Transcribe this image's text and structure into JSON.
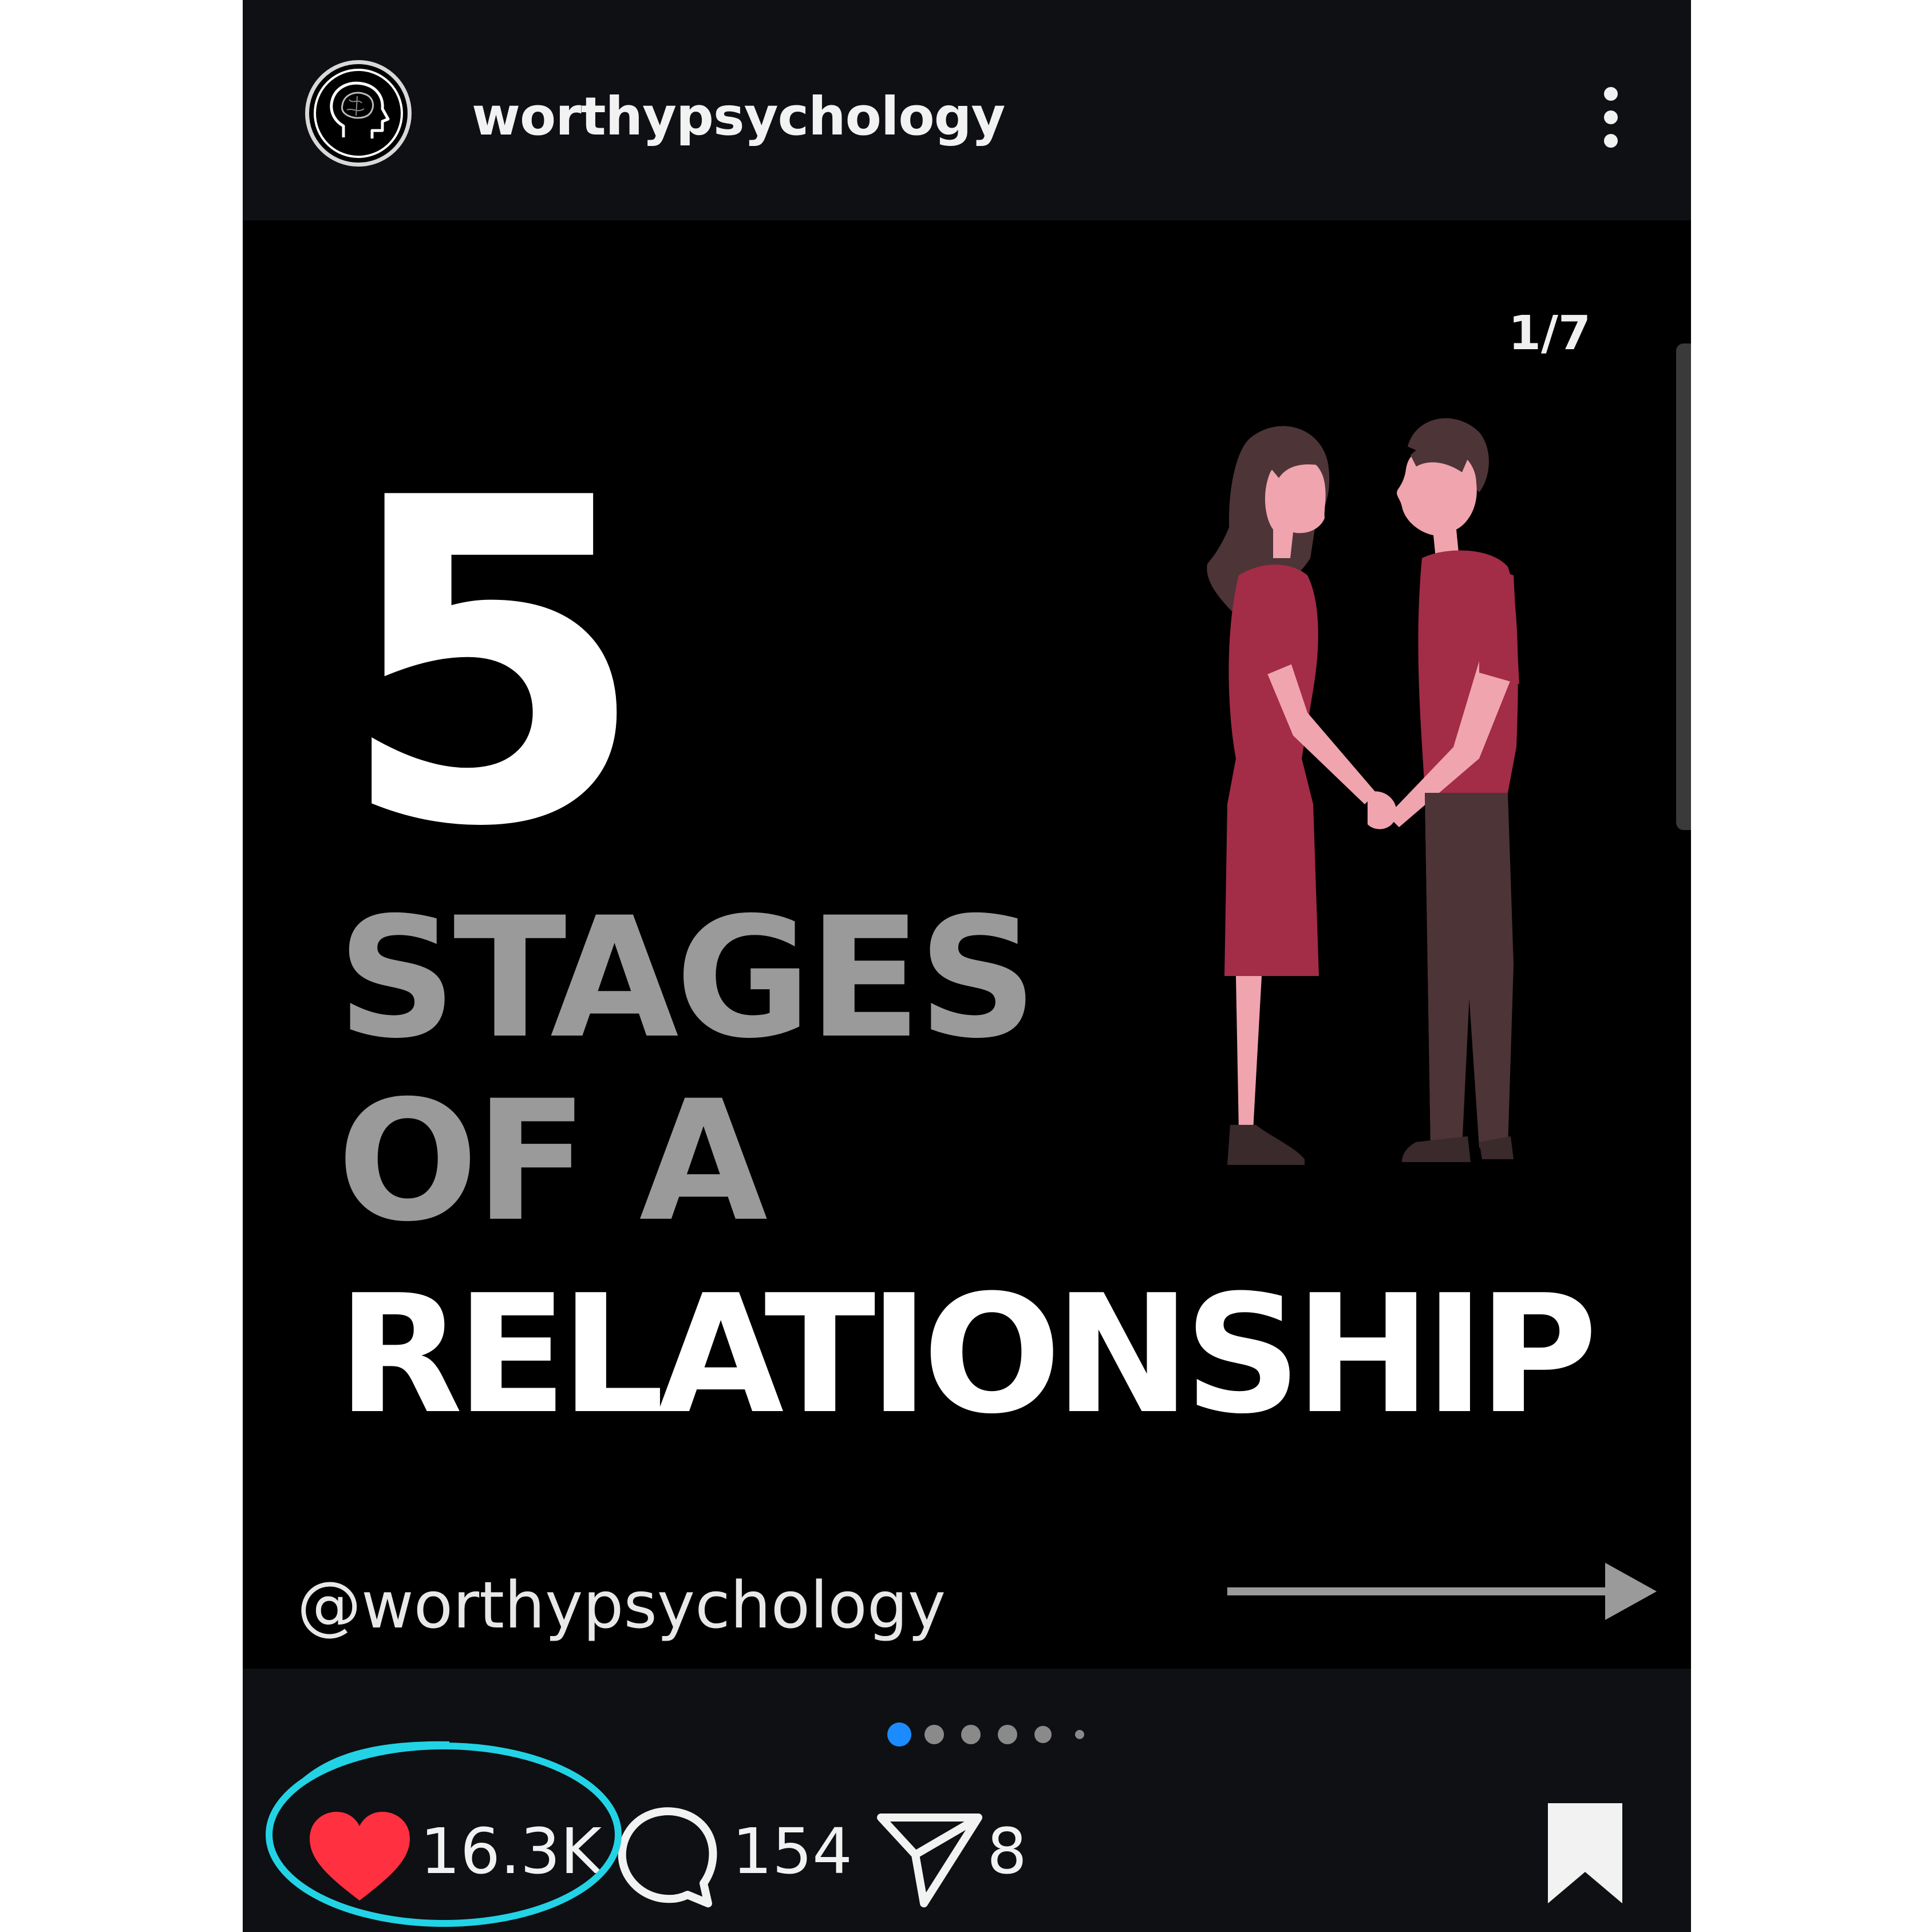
{
  "header": {
    "username": "worthypsychology"
  },
  "post": {
    "page_counter": "1/7",
    "big_number": "5",
    "headline_line1": "STAGES",
    "headline_line2": "OF A",
    "headline_line3": "RELATIONSHIP",
    "handle": "@worthypsychology",
    "carousel": {
      "total_dots": 6,
      "active_index": 0
    }
  },
  "actions": {
    "likes": "16.3K",
    "comments": "154",
    "shares": "8"
  },
  "colors": {
    "background": "#0e1013",
    "image_bg": "#000000",
    "accent_blue": "#1a8cff",
    "like_red": "#ff3040",
    "headline_gray": "#9a9a9a",
    "highlight_cyan": "#22d3e6",
    "dress_red": "#a32c46",
    "skin_pink": "#f0a4ae",
    "hair_brown": "#4d3437"
  },
  "icons": {
    "avatar": "brain-head-icon",
    "more": "more-vertical-icon",
    "like": "heart-icon",
    "comment": "comment-icon",
    "share": "paper-plane-icon",
    "save": "bookmark-icon",
    "next": "arrow-right-icon"
  }
}
